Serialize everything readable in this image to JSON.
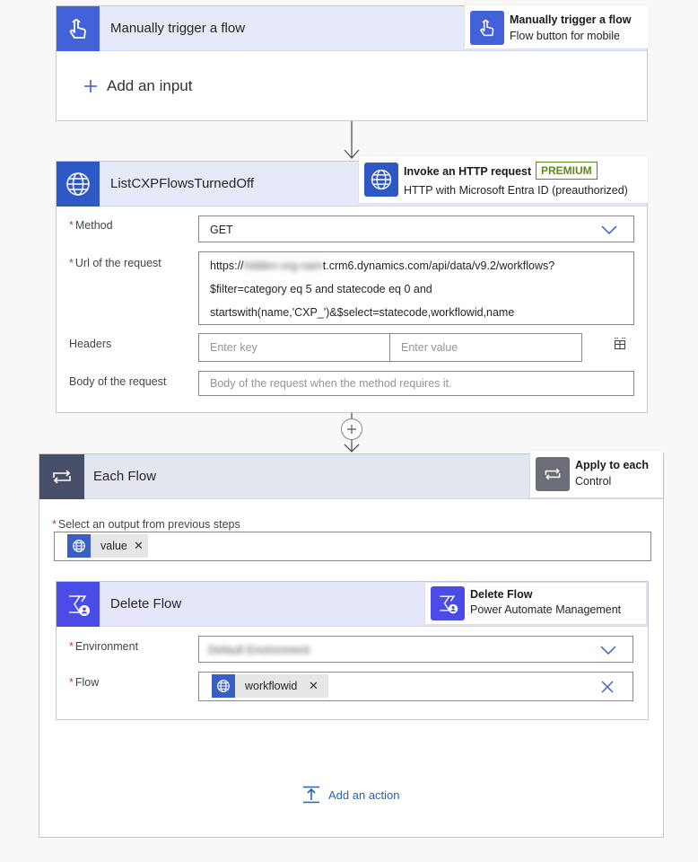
{
  "trigger": {
    "title": "Manually trigger a flow",
    "tooltip_title": "Manually trigger a flow",
    "tooltip_subtitle": "Flow button for mobile",
    "add_input_label": "Add an input",
    "accent": "#4361d8"
  },
  "http_action": {
    "title": "ListCXPFlowsTurnedOff",
    "tooltip_title": "Invoke an HTTP request",
    "premium_badge": "PREMIUM",
    "tooltip_subtitle": "HTTP with Microsoft Entra ID (preauthorized)",
    "method_label": "Method",
    "method_value": "GET",
    "url_label": "Url of the request",
    "url_prefix": "https://",
    "url_redacted": "hidden-org-nam",
    "url_line1_rest": "t.crm6.dynamics.com/api/data/v9.2/workflows?",
    "url_line2": "$filter=category eq 5 and statecode eq 0 and",
    "url_line3": "startswith(name,'CXP_')&$select=statecode,workflowid,name",
    "headers_label": "Headers",
    "key_placeholder": "Enter key",
    "value_placeholder": "Enter value",
    "body_label": "Body of the request",
    "body_placeholder": "Body of the request when the method requires it.",
    "accent": "#2e58c4"
  },
  "loop": {
    "title": "Each Flow",
    "tooltip_title": "Apply to each",
    "tooltip_subtitle": "Control",
    "select_label": "Select an output from previous steps",
    "token_label": "value",
    "accent": "#484f6b"
  },
  "delete_action": {
    "title": "Delete Flow",
    "tooltip_title": "Delete Flow",
    "tooltip_subtitle": "Power Automate Management",
    "environment_label": "Environment",
    "environment_value_redacted": "Default Environment",
    "flow_label": "Flow",
    "flow_token_label": "workflowid",
    "accent": "#4b4be6"
  },
  "add_action_label": "Add an action",
  "colors": {
    "link_blue": "#2b5fb4",
    "premium_green": "#5c8a1a",
    "header_tint": "#e6eaf8"
  },
  "icons": {
    "trigger": "touch-hand-icon",
    "http": "globe-icon",
    "loop": "loop-arrows-icon",
    "delete": "power-automate-management-icon",
    "dropdown": "chevron-down-icon",
    "clear": "close-icon",
    "add": "plus-icon",
    "headers_mode": "table-switch-icon",
    "add_action": "insert-step-icon"
  }
}
